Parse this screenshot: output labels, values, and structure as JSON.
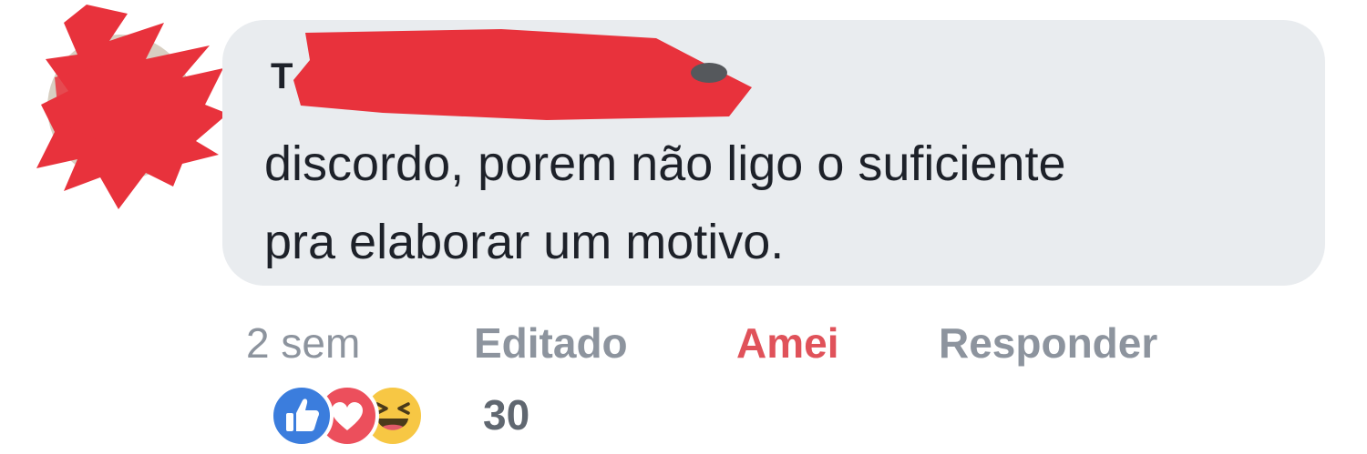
{
  "comment": {
    "author_initial": "T",
    "text_line1": "discordo, porem não ligo o suficiente",
    "text_line2": "pra elaborar um motivo."
  },
  "meta": {
    "time": "2 sem",
    "edited_label": "Editado",
    "love_label": "Amei",
    "reply_label": "Responder"
  },
  "reactions": {
    "icons": [
      "like-icon",
      "love-icon",
      "haha-icon"
    ],
    "count": "30"
  },
  "colors": {
    "bubble": "#e9ecef",
    "text": "#1d2129",
    "muted": "#8d949e",
    "love_accent": "#e0525a",
    "like_blue": "#3b7ddd",
    "heart_red": "#ec4f5c",
    "haha_yellow": "#f7c744",
    "redaction": "#e8323c"
  }
}
